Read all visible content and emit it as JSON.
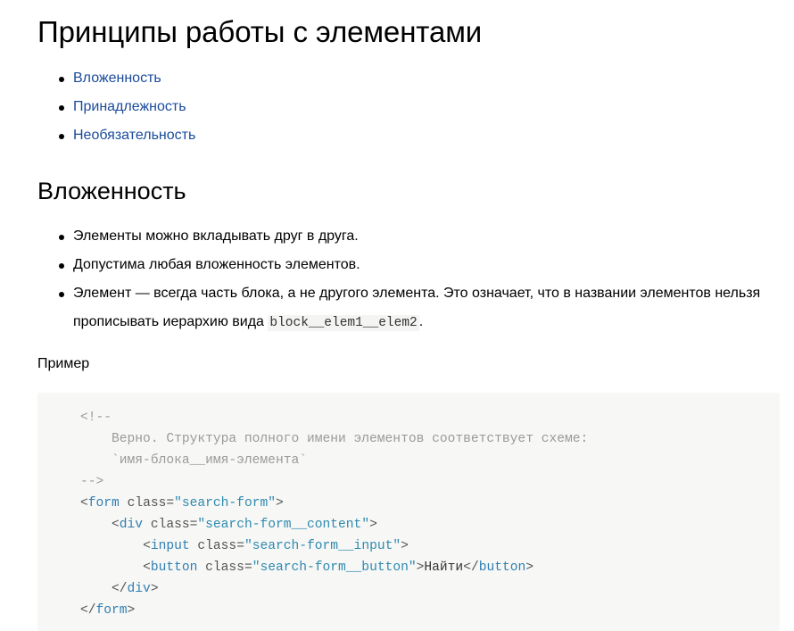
{
  "page": {
    "title": "Принципы работы с элементами"
  },
  "toc": {
    "items": [
      {
        "label": "Вложенность"
      },
      {
        "label": "Принадлежность"
      },
      {
        "label": "Необязательность"
      }
    ]
  },
  "section": {
    "title": "Вложенность",
    "points": [
      {
        "text": "Элементы можно вкладывать друг в друга."
      },
      {
        "text": "Допустима любая вложенность элементов."
      },
      {
        "text_before": "Элемент — всегда часть блока, а не другого элемента. Это означает, что в названии элементов нельзя прописывать иерархию вида ",
        "code": "block__elem1__elem2",
        "text_after": "."
      }
    ],
    "example_label": "Пример"
  },
  "code_block": {
    "comment_open": "<!--",
    "comment_line1": "    Верно. Структура полного имени элементов соответствует схеме:",
    "comment_line2": "    `имя-блока__имя-элемента`",
    "comment_close": "-->",
    "form_tag": "form",
    "form_class": "\"search-form\"",
    "div_tag": "div",
    "div_class": "\"search-form__content\"",
    "input_tag": "input",
    "input_class": "\"search-form__input\"",
    "button_tag": "button",
    "button_class": "\"search-form__button\"",
    "button_text": "Найти",
    "attr_name": "class",
    "indent1": "    ",
    "indent2": "        "
  },
  "colors": {
    "link": "#1a4b9c",
    "code_background": "#f7f7f5",
    "code_comment": "#9a9a9a",
    "code_tag": "#2f7fb3"
  }
}
